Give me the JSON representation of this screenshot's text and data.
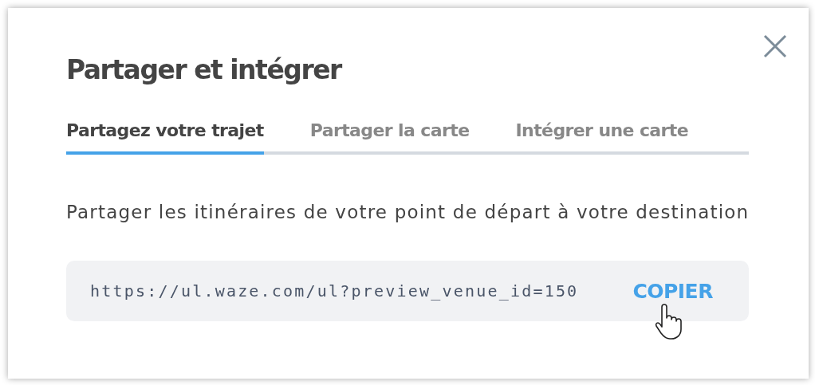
{
  "dialog": {
    "title": "Partager et intégrer"
  },
  "tabs": [
    {
      "label": "Partagez votre trajet",
      "selected": true
    },
    {
      "label": "Partager la carte",
      "selected": false
    },
    {
      "label": "Intégrer une carte",
      "selected": false
    }
  ],
  "description": "Partager les itinéraires de votre point de départ à votre destination",
  "link": {
    "value": "https://ul.waze.com/ul?preview_venue_id=150",
    "button": "COPIER"
  }
}
